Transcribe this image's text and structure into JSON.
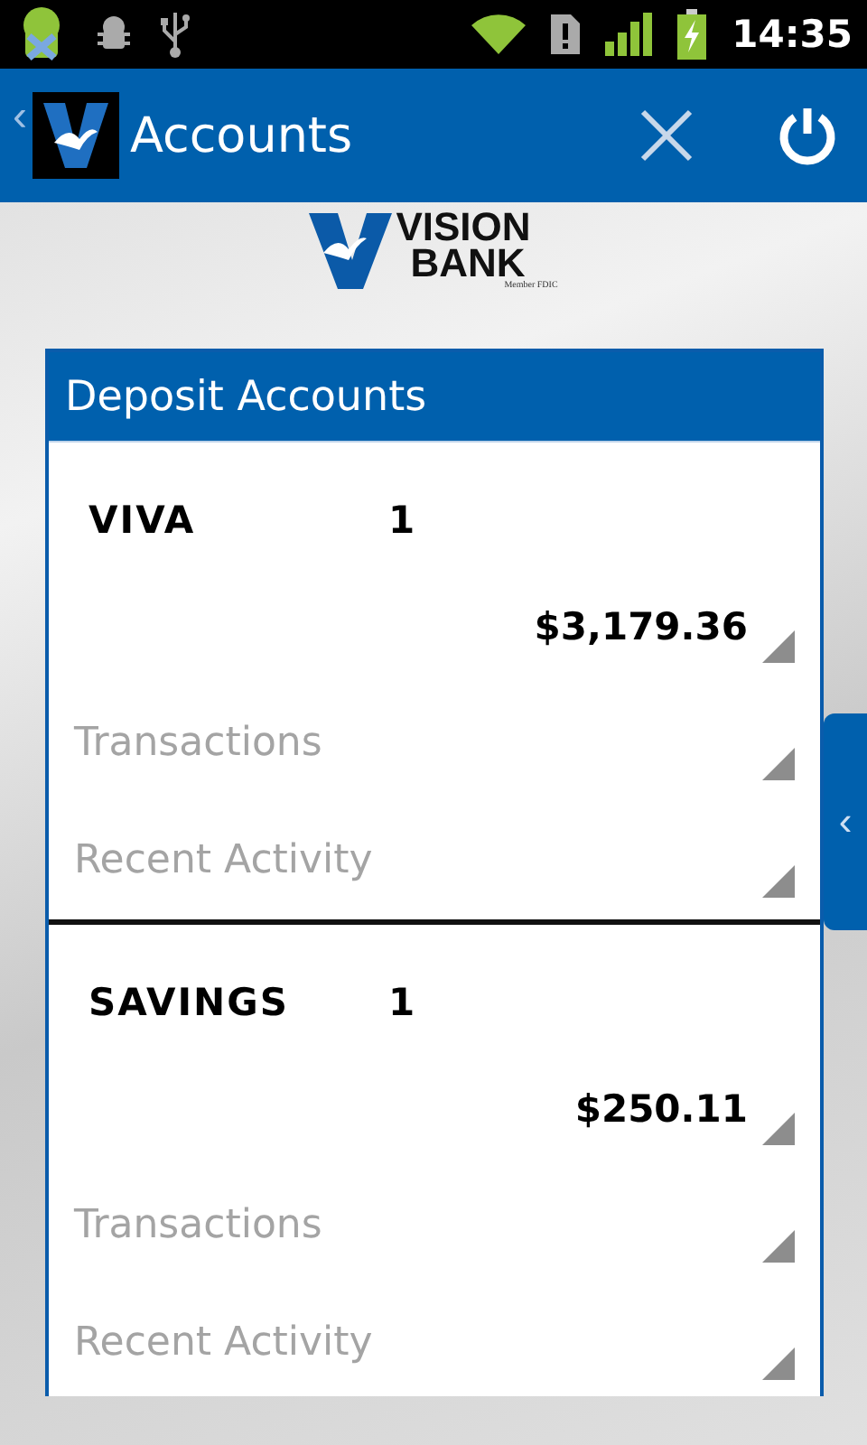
{
  "status_bar": {
    "time": "14:35"
  },
  "app_bar": {
    "title": "Accounts"
  },
  "logo": {
    "line_1": "VISION",
    "line_2": "BANK",
    "tagline": "Member FDIC"
  },
  "side_tab": {
    "glyph": "‹"
  },
  "back_glyph": "‹",
  "panel": {
    "title": "Deposit Accounts",
    "accounts": [
      {
        "name": "VIVA",
        "number": "1",
        "balance": "$3,179.36",
        "links": [
          "Transactions",
          "Recent Activity"
        ]
      },
      {
        "name": "SAVINGS",
        "number": "1",
        "balance": "$250.11",
        "links": [
          "Transactions",
          "Recent Activity"
        ]
      }
    ]
  }
}
